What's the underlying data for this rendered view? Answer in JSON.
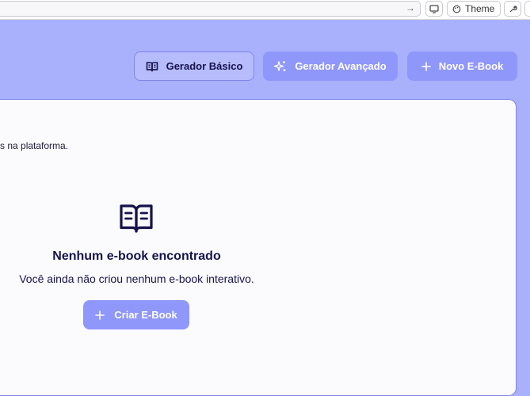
{
  "browser": {
    "theme_label": "Theme",
    "go_icon": "arrow-right-icon",
    "display_icon": "monitor-icon",
    "theme_icon": "palette-icon",
    "tool_icon": "wrench-icon"
  },
  "toolbar": {
    "basic_label": "Gerador Básico",
    "advanced_label": "Gerador Avançado",
    "new_label": "Novo E-Book"
  },
  "content": {
    "subtitle": "s na plataforma.",
    "empty_title": "Nenhum e-book encontrado",
    "empty_desc": "Você ainda não criou nenhum e-book interativo.",
    "create_label": "Criar E-Book"
  },
  "colors": {
    "background": "#a9b0fc",
    "primary_button": "#8f97fb",
    "text_dark": "#17124a"
  }
}
